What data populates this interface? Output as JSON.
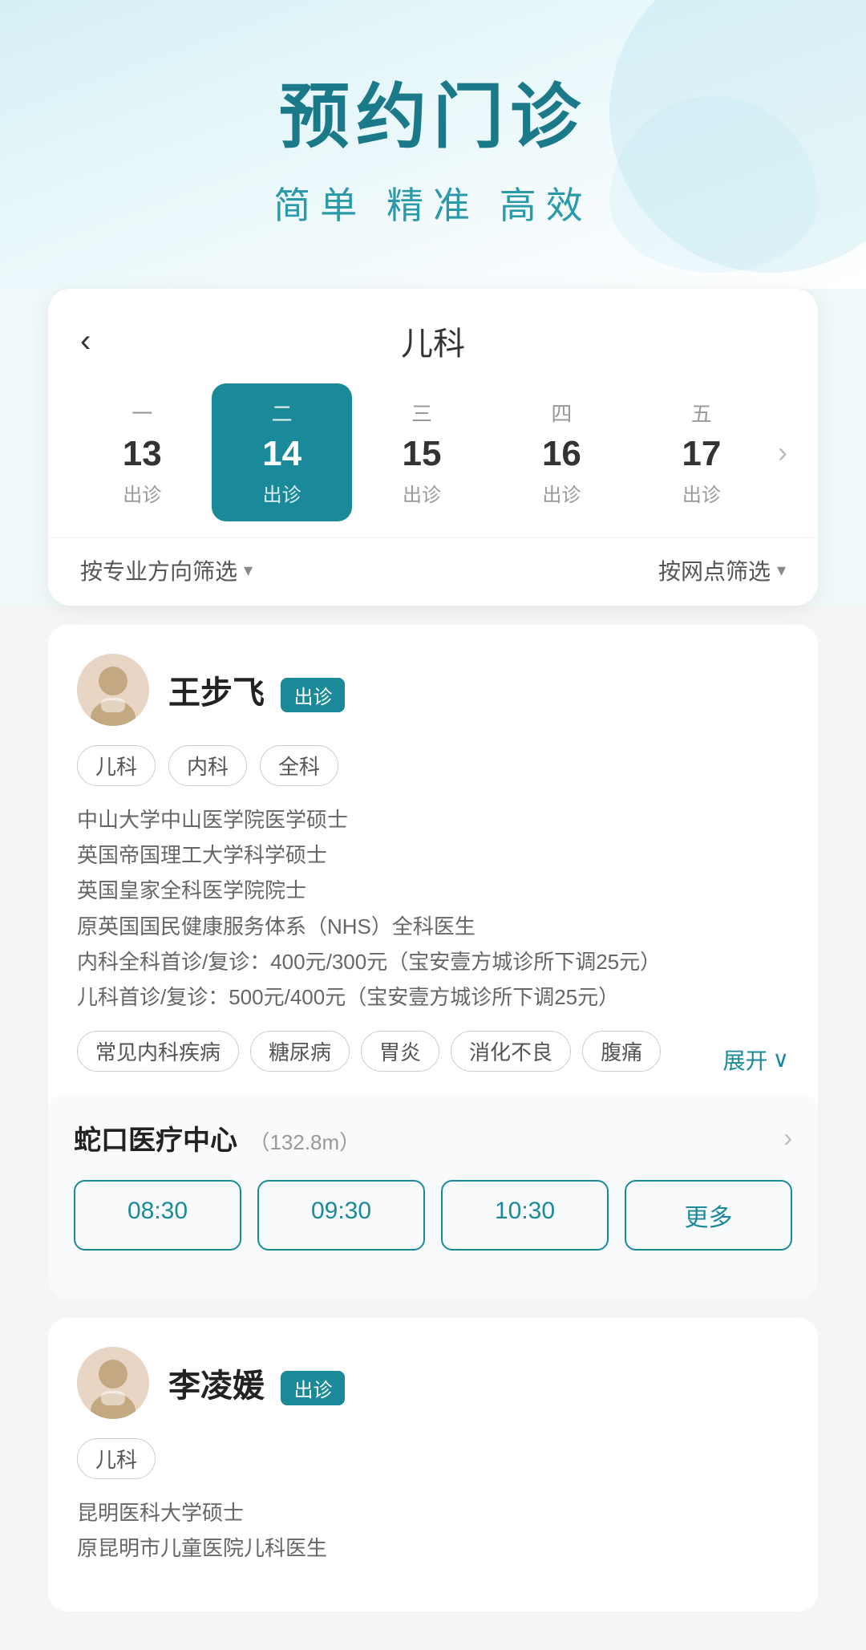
{
  "hero": {
    "title": "预约门诊",
    "subtitle": "简单 精准 高效"
  },
  "page": {
    "back_label": "‹",
    "title": "儿科",
    "calendar_arrow": "›"
  },
  "calendar": {
    "days": [
      {
        "weekday": "一",
        "number": "13",
        "status": "出诊",
        "active": false
      },
      {
        "weekday": "二",
        "number": "14",
        "status": "出诊",
        "active": true
      },
      {
        "weekday": "三",
        "number": "15",
        "status": "出诊",
        "active": false
      },
      {
        "weekday": "四",
        "number": "16",
        "status": "出诊",
        "active": false
      },
      {
        "weekday": "五",
        "number": "17",
        "status": "出诊",
        "active": false
      }
    ]
  },
  "filters": {
    "specialty": "按专业方向筛选",
    "location": "按网点筛选"
  },
  "doctors": [
    {
      "id": "wang",
      "avatar_emoji": "👩‍⚕️",
      "name": "王步飞",
      "status": "出诊",
      "tags": [
        "儿科",
        "内科",
        "全科"
      ],
      "description": "中山大学中山医学院医学硕士\n英国帝国理工大学科学硕士\n英国皇家全科医学院院士\n原英国国民健康服务体系（NHS）全科医生\n内科全科首诊/复诊：400元/300元（宝安壹方城诊所下调25元）\n儿科首诊/复诊：500元/400元（宝安壹方城诊所下调25元）",
      "specialties": [
        "常见内科疾病",
        "糖尿病",
        "胃炎",
        "消化不良",
        "腹痛"
      ],
      "expand_label": "展开",
      "clinic": {
        "name": "蛇口医疗中心",
        "distance": "（132.8m）",
        "time_slots": [
          "08:30",
          "09:30",
          "10:30",
          "更多"
        ]
      }
    },
    {
      "id": "li",
      "avatar_emoji": "👩‍⚕️",
      "name": "李凌媛",
      "status": "出诊",
      "tags": [
        "儿科"
      ],
      "description": "昆明医科大学硕士\n原昆明市儿童医院儿科医生",
      "specialties": []
    }
  ]
}
